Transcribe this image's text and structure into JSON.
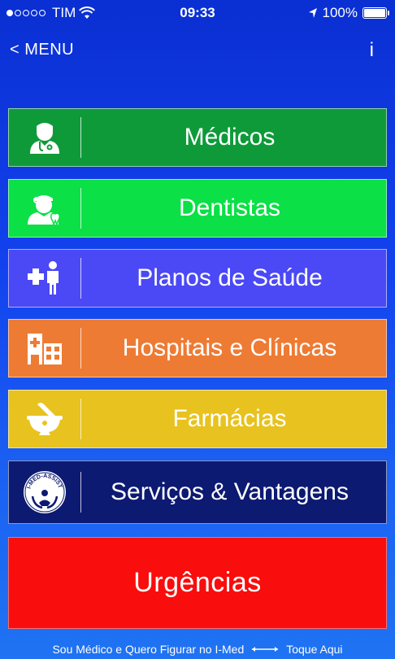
{
  "status": {
    "carrier": "TIM",
    "time": "09:33",
    "battery": "100%"
  },
  "nav": {
    "back_label": "< MENU",
    "info_label": "i"
  },
  "menu": {
    "medicos": "Médicos",
    "dentistas": "Dentistas",
    "planos": "Planos de Saúde",
    "hospitais": "Hospitais e Clínicas",
    "farmacias": "Farmácias",
    "servicos": "Serviços & Vantagens",
    "urgencias": "Urgências"
  },
  "footer": {
    "text": "Sou Médico e Quero Figurar no I-Med",
    "link": "Toque Aqui"
  },
  "colors": {
    "medicos": "#0f9a3a",
    "dentistas": "#0be046",
    "planos": "#4b48f6",
    "hospitais": "#ee7b33",
    "farmacias": "#e8c21e",
    "servicos": "#0c1a72",
    "urgencias": "#f90d0d"
  },
  "icons": {
    "medicos": "doctor-icon",
    "dentistas": "dentist-icon",
    "planos": "health-plan-icon",
    "hospitais": "hospital-icon",
    "farmacias": "mortar-pestle-icon",
    "servicos": "i-med-assist-logo"
  },
  "logo_text": "I-MED-ASSIST"
}
